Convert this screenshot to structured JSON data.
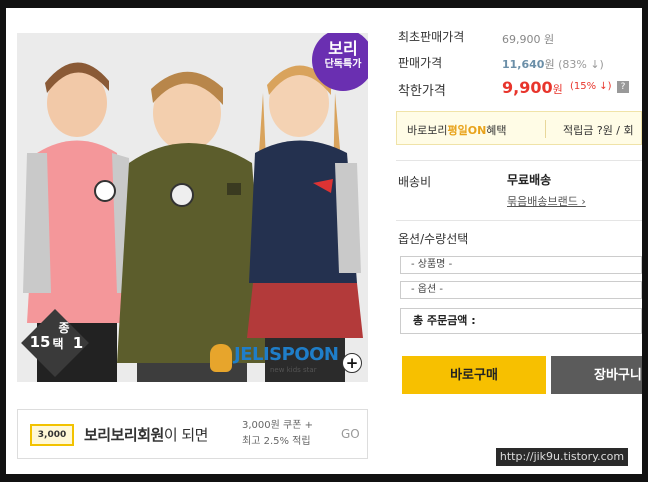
{
  "product_image": {
    "badge_top_line1": "보리",
    "badge_top_line2": "단독특가",
    "badge_bottom_count": "15",
    "badge_bottom_unit": "종",
    "badge_bottom_pick": "택",
    "badge_bottom_one": "1",
    "brand_name": "JELISPOON",
    "brand_sub": "new kids star",
    "zoom_symbol": "+"
  },
  "member_banner": {
    "coupon_icon_text": "3,000",
    "label_bold": "보리보리회원",
    "label_rest": "이 되면",
    "desc_line1": "3,000원 쿠폰 +",
    "desc_line2": "최고 2.5% 적립",
    "go": "GO"
  },
  "price": {
    "lowest_label": "최초판매가격",
    "lowest_value": "69,900 원",
    "sale_label": "판매가격",
    "sale_value": "11,640",
    "sale_unit": "원",
    "sale_discount": "(83% ↓)",
    "final_label": "착한가격",
    "final_value": "9,900",
    "final_unit": "원",
    "final_discount": "(15% ↓)",
    "help": "?"
  },
  "promo": {
    "prefix": "바로보리",
    "highlight": "평일ON",
    "suffix": "혜택",
    "points": "적립금 ?원 / 회"
  },
  "shipping": {
    "label": "배송비",
    "value": "무료배송",
    "bundle": "묶음배송브랜드 ›"
  },
  "options": {
    "label": "옵션/수량선택",
    "product_select": "- 상품명 -",
    "option_select": "- 옵션 -",
    "total_label": "총 주문금액 :"
  },
  "buttons": {
    "buy": "바로구매",
    "cart": "장바구니"
  },
  "watermark": "http://jik9u.tistory.com"
}
